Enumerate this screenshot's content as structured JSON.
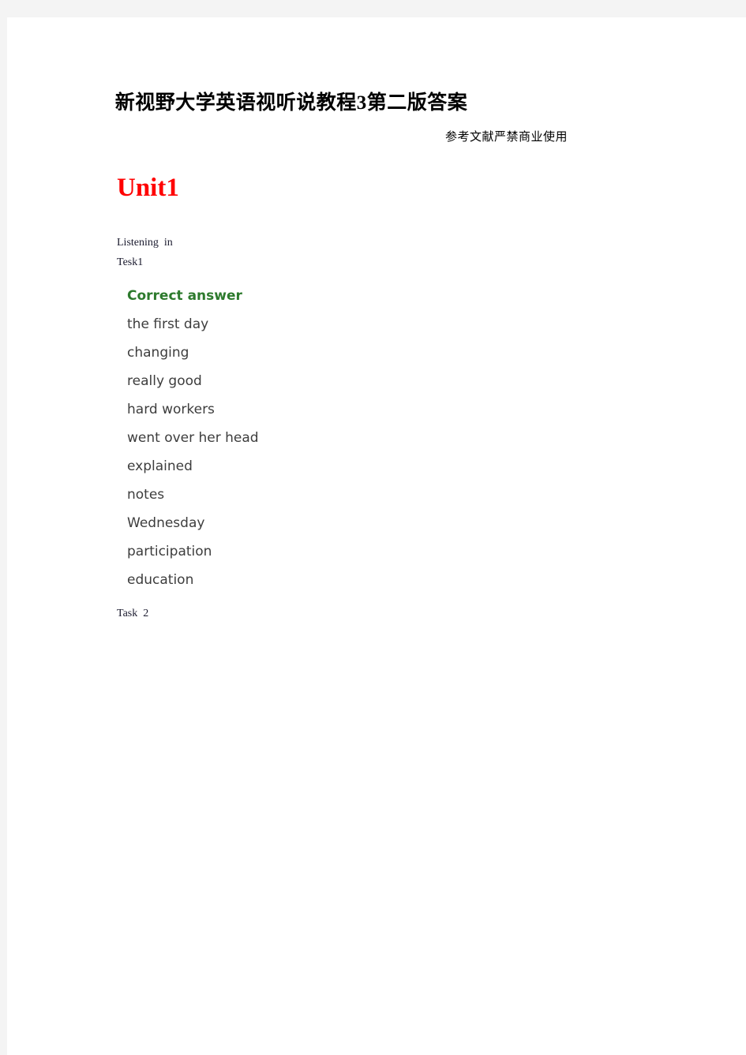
{
  "page": {
    "background_color": "#f4f4f4",
    "sheet_color": "#ffffff"
  },
  "header": {
    "title": "新视野大学英语视听说教程3第二版答案",
    "subtitle": "参考文献严禁商业使用"
  },
  "unit": {
    "heading": "Unit1",
    "heading_color": "#ff0000"
  },
  "section": {
    "listening_label": "Listening  in",
    "task_1_label": "Tesk1",
    "task_2_label": "Task  2"
  },
  "answer_key": {
    "heading": "Correct answer",
    "heading_color": "#2d7a2d",
    "items": [
      "the first day",
      "changing",
      "really good",
      "hard workers",
      "went over her head",
      "explained",
      "notes",
      "Wednesday",
      "participation",
      "education"
    ]
  }
}
